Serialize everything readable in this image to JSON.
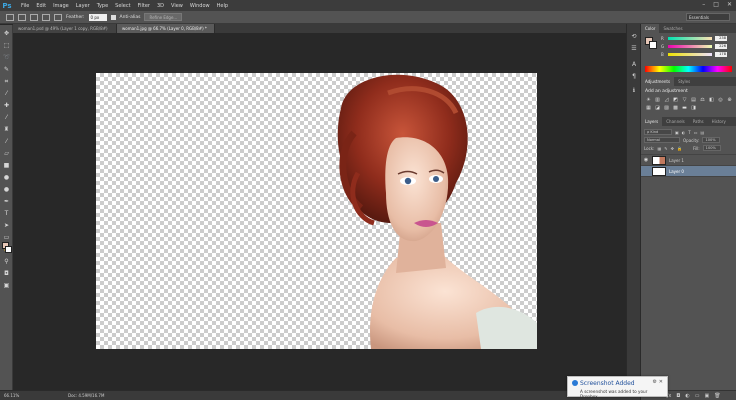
{
  "app": {
    "logo": "Ps",
    "window_controls": [
      "–",
      "□",
      "✕"
    ]
  },
  "menu": [
    "File",
    "Edit",
    "Image",
    "Layer",
    "Type",
    "Select",
    "Filter",
    "3D",
    "View",
    "Window",
    "Help"
  ],
  "options": {
    "feather_label": "Feather:",
    "feather_value": "0 px",
    "anti_alias_label": "Anti-alias",
    "refine_edge_label": "Refine Edge...",
    "workspace": "Essentials"
  },
  "tabs": [
    {
      "label": "woman1.psd @ 49% (Layer 1 copy, RGB/8#)"
    },
    {
      "label": "woman1.jpg @ 66.7% (Layer 0, RGB/8#) *"
    }
  ],
  "status": {
    "zoom": "66.11%",
    "doc": "Doc: 4.59M/16.7M"
  },
  "color_panel": {
    "tabs": [
      "Color",
      "Swatches"
    ],
    "foreground": "#e8c8b8",
    "background": "#ffffff",
    "sliders": [
      {
        "letter": "R",
        "value": "238"
      },
      {
        "letter": "G",
        "value": "226"
      },
      {
        "letter": "B",
        "value": "178"
      }
    ]
  },
  "adjustments_panel": {
    "tabs": [
      "Adjustments",
      "Styles"
    ],
    "title": "Add an adjustment"
  },
  "layers_panel": {
    "tabs": [
      "Layers",
      "Channels",
      "Paths",
      "History"
    ],
    "kind": "ρ Kind",
    "blend": "Normal",
    "opacity_label": "Opacity:",
    "opacity_value": "100%",
    "lock_label": "Lock:",
    "fill_label": "Fill:",
    "fill_value": "100%",
    "layers": [
      {
        "name": "Layer 1",
        "selected": false
      },
      {
        "name": "Layer 0",
        "selected": true
      }
    ]
  },
  "toast": {
    "title": "Screenshot Added",
    "body": "A screenshot was added to your Dropbox."
  }
}
